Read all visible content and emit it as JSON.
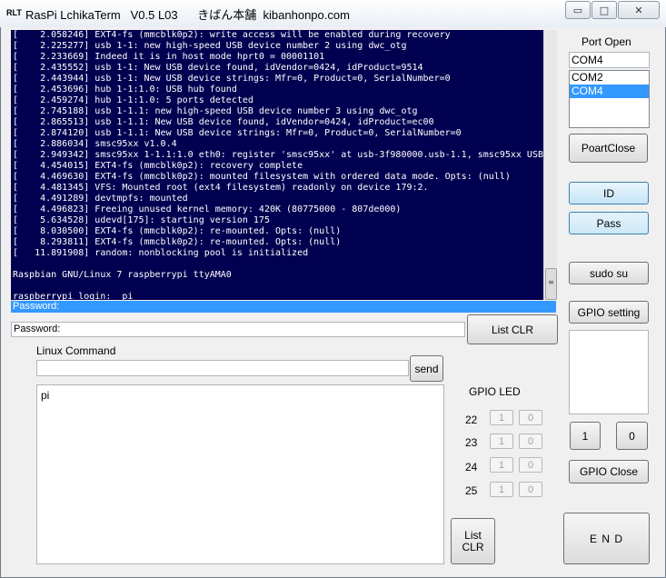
{
  "window": {
    "logo": "RLT",
    "title": "RasPi LchikaTerm   V0.5 L03      きばん本舗  kibanhonpo.com",
    "minimize_glyph": "▭",
    "maximize_glyph": "□",
    "close_glyph": "✕"
  },
  "terminal": {
    "lines": [
      "[    2.058246] EXT4-fs (mmcblk0p2): write access will be enabled during recovery",
      "[    2.225277] usb 1-1: new high-speed USB device number 2 using dwc_otg",
      "[    2.233669] Indeed it is in host mode hprt0 = 00001101",
      "[    2.435552] usb 1-1: New USB device found, idVendor=0424, idProduct=9514",
      "[    2.443944] usb 1-1: New USB device strings: Mfr=0, Product=0, SerialNumber=0",
      "[    2.453696] hub 1-1:1.0: USB hub found",
      "[    2.459274] hub 1-1:1.0: 5 ports detected",
      "[    2.745188] usb 1-1.1: new high-speed USB device number 3 using dwc_otg",
      "[    2.865513] usb 1-1.1: New USB device found, idVendor=0424, idProduct=ec00",
      "[    2.874120] usb 1-1.1: New USB device strings: Mfr=0, Product=0, SerialNumber=0",
      "[    2.886034] smsc95xx v1.0.4",
      "[    2.949342] smsc95xx 1-1.1:1.0 eth0: register 'smsc95xx' at usb-3f980000.usb-1.1, smsc95xx USB",
      "[    4.454015] EXT4-fs (mmcblk0p2): recovery complete",
      "[    4.469630] EXT4-fs (mmcblk0p2): mounted filesystem with ordered data mode. Opts: (null)",
      "[    4.481345] VFS: Mounted root (ext4 filesystem) readonly on device 179:2.",
      "[    4.491289] devtmpfs: mounted",
      "[    4.496823] Freeing unused kernel memory: 420K (80775000 - 807de000)",
      "[    5.634528] udevd[175]: starting version 175",
      "[    8.030500] EXT4-fs (mmcblk0p2): re-mounted. Opts: (null)",
      "[    8.293811] EXT4-fs (mmcblk0p2): re-mounted. Opts: (null)",
      "[   11.891908] random: nonblocking pool is initialized",
      "",
      "Raspbian GNU/Linux 7 raspberrypi ttyAMA0",
      "",
      "raspberrypi login:  pi"
    ],
    "input_line": "Password:",
    "scroll_glyph": "≡"
  },
  "password_field": {
    "value": "Password:"
  },
  "list_clr_top": "List CLR",
  "linux_command": {
    "label": "Linux Command",
    "value": "",
    "send_label": "send",
    "history": "pi"
  },
  "list_clr_bottom_line1": "List",
  "list_clr_bottom_line2": "CLR",
  "gpio_led": {
    "title": "GPIO LED",
    "rows": [
      {
        "pin": "22",
        "on": "1",
        "off": "0"
      },
      {
        "pin": "23",
        "on": "1",
        "off": "0"
      },
      {
        "pin": "24",
        "on": "1",
        "off": "0"
      },
      {
        "pin": "25",
        "on": "1",
        "off": "0"
      }
    ]
  },
  "port": {
    "open_label": "Port Open",
    "value": "COM4",
    "options": [
      "COM2",
      "COM4"
    ],
    "selected_index": 1,
    "close_label": "PoartClose"
  },
  "buttons": {
    "id": "ID",
    "pass": "Pass",
    "sudo": "sudo su",
    "gpio_setting": "GPIO setting",
    "one": "1",
    "zero": "0",
    "gpio_close": "GPIO Close",
    "end": "E N D"
  }
}
